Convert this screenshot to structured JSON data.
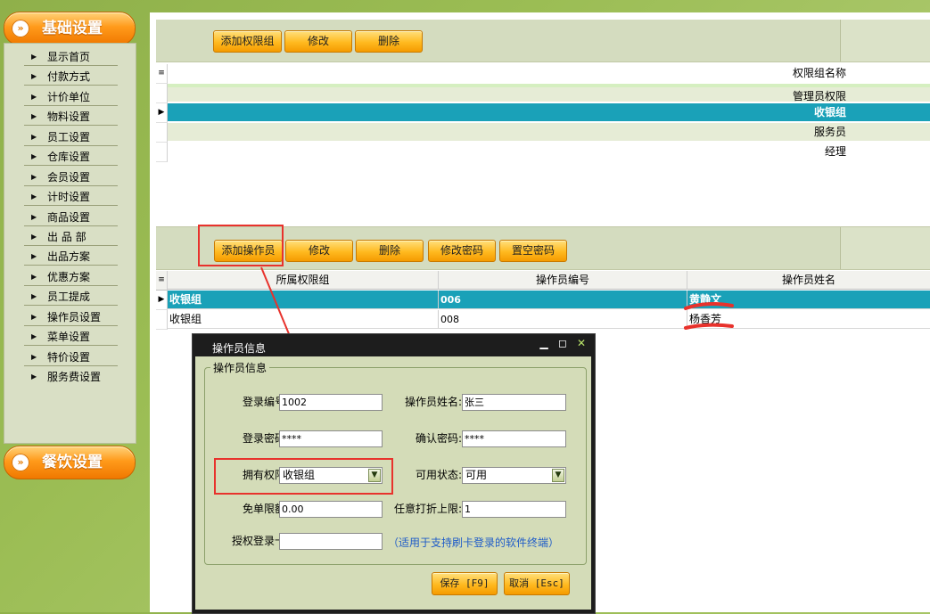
{
  "sidebar": {
    "header_main": "基础设置",
    "header_food": "餐饮设置",
    "items": [
      "显示首页",
      "付款方式",
      "计价单位",
      "物料设置",
      "员工设置",
      "仓库设置",
      "会员设置",
      "计时设置",
      "商品设置",
      "出 品 部",
      "出品方案",
      "优惠方案",
      "员工提成",
      "操作员设置",
      "菜单设置",
      "特价设置",
      "服务费设置"
    ]
  },
  "perm_toolbar": {
    "add": "添加权限组",
    "edit": "修改",
    "delete": "删除"
  },
  "perm_grid": {
    "header": "权限组名称",
    "rows": [
      "管理员权限",
      "收银组",
      "服务员",
      "经理"
    ],
    "selected_index": 1
  },
  "op_toolbar": {
    "add": "添加操作员",
    "edit": "修改",
    "delete": "删除",
    "change_pwd": "修改密码",
    "clear_pwd": "置空密码"
  },
  "op_grid": {
    "headers": [
      "所属权限组",
      "操作员编号",
      "操作员姓名"
    ],
    "rows": [
      {
        "group": "收银组",
        "code": "006",
        "name": "黄静文"
      },
      {
        "group": "收银组",
        "code": "008",
        "name": "杨香芳"
      }
    ],
    "selected_index": 0
  },
  "dialog": {
    "title": "操作员信息",
    "section": "操作员信息",
    "login_code_label": "登录编号:",
    "login_code": "1002",
    "op_name_label": "操作员姓名:",
    "op_name": "张三",
    "login_pwd_label": "登录密码:",
    "login_pwd": "****",
    "confirm_pwd_label": "确认密码:",
    "confirm_pwd": "****",
    "permission_label": "拥有权限:",
    "permission": "收银组",
    "status_label": "可用状态:",
    "status": "可用",
    "free_limit_label": "免单限额:",
    "free_limit": "0.00",
    "discount_label": "任意打折上限:",
    "discount": "1",
    "card_label": "授权登录卡:",
    "card": "",
    "card_hint": "（适用于支持刷卡登录的软件终端）",
    "save": "保存 [F9]",
    "cancel": "取消 [Esc]"
  },
  "colors": {
    "selected_row": "#1aa1b8",
    "button": "#ffb91f",
    "annotation": "#e8322c"
  }
}
